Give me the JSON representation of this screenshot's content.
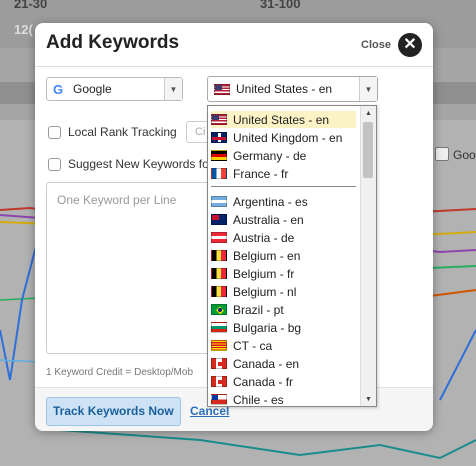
{
  "background": {
    "headers": [
      "21-30",
      "31-100"
    ],
    "sub_header": "12(",
    "right_checkbox_label": "Goo"
  },
  "modal": {
    "title": "Add Keywords",
    "close_label": "Close",
    "close_icon": "close-icon",
    "engine": {
      "icon": "google-icon",
      "icon_glyph": "G",
      "value": "Google"
    },
    "location": {
      "value": "United States - en",
      "flag": "us"
    },
    "local_rank_tracking": "Local Rank Tracking",
    "city_placeholder": "Ci",
    "suggest_keywords": "Suggest New Keywords fo",
    "keyword_placeholder": "One Keyword per Line",
    "credit_note": "1 Keyword Credit = Desktop/Mob",
    "track_button": "Track Keywords Now",
    "cancel_link": "Cancel"
  },
  "location_dropdown": {
    "top_items": [
      {
        "label": "United States - en",
        "flag": "us",
        "selected": true
      },
      {
        "label": "United Kingdom - en",
        "flag": "uk"
      },
      {
        "label": "Germany - de",
        "flag": "de"
      },
      {
        "label": "France - fr",
        "flag": "fr"
      }
    ],
    "items": [
      {
        "label": "Argentina - es",
        "flag": "ar"
      },
      {
        "label": "Australia - en",
        "flag": "au"
      },
      {
        "label": "Austria - de",
        "flag": "at"
      },
      {
        "label": "Belgium - en",
        "flag": "be"
      },
      {
        "label": "Belgium - fr",
        "flag": "be"
      },
      {
        "label": "Belgium - nl",
        "flag": "be"
      },
      {
        "label": "Brazil - pt",
        "flag": "br"
      },
      {
        "label": "Bulgaria - bg",
        "flag": "bg"
      },
      {
        "label": "CT - ca",
        "flag": "ct"
      },
      {
        "label": "Canada - en",
        "flag": "ca"
      },
      {
        "label": "Canada - fr",
        "flag": "ca"
      },
      {
        "label": "Chile - es",
        "flag": "cl"
      }
    ]
  }
}
